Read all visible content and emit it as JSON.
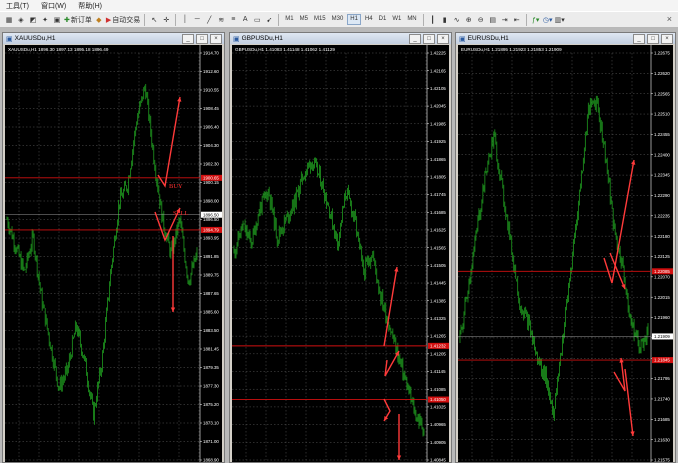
{
  "menu": {
    "items": [
      "工具(T)",
      "窗口(W)",
      "帮助(H)"
    ]
  },
  "toolbar": {
    "new_order_label": "新订单",
    "auto_trade_label": "自动交易",
    "timeframes": [
      "M1",
      "M5",
      "M15",
      "M30",
      "H1",
      "H4",
      "D1",
      "W1",
      "MN"
    ],
    "active_timeframe": "H1",
    "close_glyph": "×"
  },
  "colors": {
    "background": "#000000",
    "grid": "#5a5a5a",
    "candles": "#1f9a1f",
    "level_lines": "#d21010",
    "arrows": "#ff3a3a",
    "price_label": "#d21010"
  },
  "windows": [
    {
      "title": "XAUUSDu,H1",
      "header": "XAUUSDu,H1  1896.30 1897.13 1895.18 1896.49",
      "ticks": [
        "1914.70",
        "1912.60",
        "1910.55",
        "1908.45",
        "1906.40",
        "1904.30",
        "1902.30",
        "1900.15",
        "1898.00",
        "1896.50",
        "1893.95",
        "1891.85",
        "1889.75",
        "1887.65",
        "1885.60",
        "1883.50",
        "1881.45",
        "1879.35",
        "1877.30",
        "1875.20",
        "1873.10",
        "1871.00",
        "1868.90"
      ],
      "tick_top": 1914.7,
      "tick_bottom": 1868.9,
      "current_price": "1896.50",
      "levels": [
        {
          "price": 1900.65,
          "label": "1900.65"
        },
        {
          "price": 1894.79,
          "label": "1894.79"
        }
      ],
      "series": {
        "ref": [
          1896,
          1893,
          1890,
          1894,
          1887,
          1882,
          1877,
          1879,
          1884,
          1880,
          1874,
          1880,
          1890,
          1898,
          1900,
          1907,
          1911,
          1903,
          1896,
          1892,
          1896,
          1889,
          1892
        ],
        "steps": 190,
        "seed": 7
      },
      "annotations": [
        {
          "text": "BUY",
          "x": 169,
          "y": 188
        },
        {
          "text": "SELL",
          "x": 173,
          "y": 215
        }
      ],
      "arrows": [
        {
          "from": [
            158,
            175
          ],
          "via": [
            165,
            186
          ],
          "to": [
            180,
            97
          ]
        },
        {
          "from": [
            155,
            212
          ],
          "via": [
            165,
            240
          ],
          "to": [
            180,
            208
          ]
        },
        {
          "from": [
            173,
            236
          ],
          "to": [
            173,
            312
          ]
        }
      ]
    },
    {
      "title": "GBPUSDu,H1",
      "header": "GBPUSDu,H1  1.41083 1.41148 1.41062 1.41129",
      "ticks": [
        "1.42225",
        "1.42165",
        "1.42105",
        "1.42045",
        "1.41985",
        "1.41925",
        "1.41865",
        "1.41805",
        "1.41745",
        "1.41685",
        "1.41625",
        "1.41565",
        "1.41505",
        "1.41445",
        "1.41385",
        "1.41325",
        "1.41265",
        "1.41205",
        "1.41145",
        "1.41085",
        "1.41025",
        "1.40965",
        "1.40905",
        "1.40845"
      ],
      "tick_top": 1.42225,
      "tick_bottom": 1.40845,
      "current_price": "",
      "levels": [
        {
          "price": 1.41232,
          "label": "1.41232"
        },
        {
          "price": 1.4105,
          "label": "1.41050"
        }
      ],
      "series": {
        "ref": [
          1.4155,
          1.4164,
          1.4158,
          1.417,
          1.4176,
          1.416,
          1.4166,
          1.4172,
          1.4181,
          1.4186,
          1.418,
          1.417,
          1.4158,
          1.4176,
          1.4166,
          1.4148,
          1.4155,
          1.414,
          1.413,
          1.412,
          1.411,
          1.41,
          1.4095
        ],
        "steps": 190,
        "seed": 11
      },
      "annotations": [],
      "arrows": [
        {
          "from": [
            384,
            346
          ],
          "to": [
            397,
            267
          ]
        },
        {
          "from": [
            387,
            360
          ],
          "via": [
            385,
            376
          ],
          "to": [
            399,
            351
          ]
        },
        {
          "from": [
            384,
            399
          ],
          "via": [
            390,
            411
          ],
          "to": [
            384,
            421
          ]
        },
        {
          "from": [
            399,
            414
          ],
          "to": [
            399,
            460
          ]
        }
      ]
    },
    {
      "title": "EURUSDu,H1",
      "header": "EURUSDu,H1  1.21895 1.21923 1.21853 1.21909",
      "ticks": [
        "1.22675",
        "1.22620",
        "1.22565",
        "1.22510",
        "1.22455",
        "1.22400",
        "1.22345",
        "1.22290",
        "1.22235",
        "1.22180",
        "1.22125",
        "1.22070",
        "1.22015",
        "1.21960",
        "1.21909",
        "1.21850",
        "1.21795",
        "1.21740",
        "1.21685",
        "1.21630",
        "1.21575"
      ],
      "tick_top": 1.22675,
      "tick_bottom": 1.21575,
      "current_price": "1.21909",
      "levels": [
        {
          "price": 1.22085,
          "label": "1.22085"
        },
        {
          "price": 1.21845,
          "label": "1.21845"
        }
      ],
      "series": {
        "ref": [
          1.219,
          1.2205,
          1.222,
          1.2235,
          1.2245,
          1.223,
          1.2215,
          1.22,
          1.2195,
          1.2185,
          1.218,
          1.217,
          1.219,
          1.221,
          1.223,
          1.2252,
          1.2255,
          1.224,
          1.222,
          1.221,
          1.2195,
          1.2188,
          1.2192
        ],
        "steps": 190,
        "seed": 19
      },
      "annotations": [],
      "arrows": [
        {
          "from": [
            604,
            258
          ],
          "via": [
            612,
            283
          ],
          "to": [
            634,
            160
          ]
        },
        {
          "from": [
            610,
            253
          ],
          "to": [
            625,
            289
          ]
        },
        {
          "from": [
            614,
            372
          ],
          "via": [
            625,
            391
          ],
          "to": [
            621,
            358
          ]
        },
        {
          "from": [
            625,
            369
          ],
          "to": [
            633,
            436
          ]
        }
      ]
    }
  ]
}
